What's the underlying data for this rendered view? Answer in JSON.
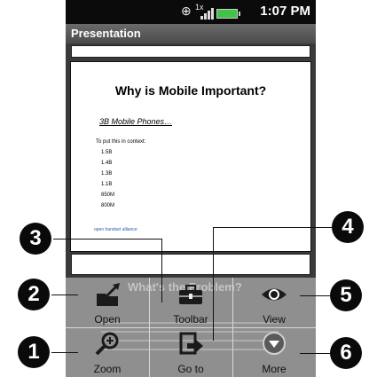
{
  "status": {
    "time": "1:07 PM",
    "network": "1x"
  },
  "app": {
    "title": "Presentation"
  },
  "slide": {
    "title": "Why is Mobile Important?",
    "subtitle": "3B Mobile Phones…",
    "context": "To put this in context:",
    "values": [
      "1.5B",
      "1.4B",
      "1.3B",
      "1.1B",
      "850M",
      "800M"
    ],
    "footer": "open handset alliance"
  },
  "background_slide_title": "What's the Problem?",
  "menu": {
    "open": "Open",
    "toolbar": "Toolbar",
    "view": "View",
    "zoom": "Zoom",
    "goto": "Go to",
    "more": "More"
  },
  "callouts": {
    "c1": "1",
    "c2": "2",
    "c3": "3",
    "c4": "4",
    "c5": "5",
    "c6": "6"
  },
  "colors": {
    "battery": "#43c24a",
    "accent_link": "#2d5dab"
  }
}
